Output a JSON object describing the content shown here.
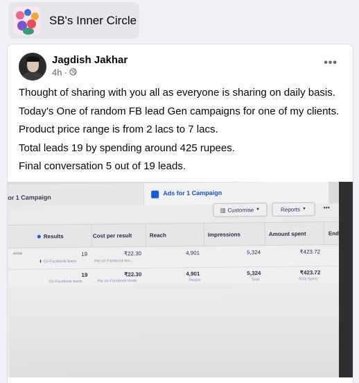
{
  "group": {
    "name": "SB's Inner Circle",
    "logo_icon": "group-cover-image"
  },
  "post": {
    "author": "Jagdish Jakhar",
    "time": "4h",
    "separator": "·",
    "privacy_icon": "globe-icon",
    "more_icon": "more-horizontal-icon",
    "more_text": "•••",
    "paragraphs": [
      "Thought of sharing with you all as everyone is sharing on daily basis.",
      "Today's One of random FB lead Gen campaigns for one of my clients.",
      "Product price range is from 2 lacs  to 7 lacs.",
      "Total leads 19 by spending around 425 rupees.",
      "Final conversation 5 out of 19 leads."
    ]
  },
  "photo": {
    "tabs": [
      "or 1 Campaign",
      "Ads for 1 Campaign"
    ],
    "buttons": {
      "customise": "Customise",
      "reports": "Reports",
      "more": "•••"
    },
    "columns": [
      "Results",
      "Cost per result",
      "Reach",
      "Impressions",
      "Amount spent",
      "Ends"
    ],
    "rows": [
      {
        "first": "ense",
        "results": "19",
        "results_sub": "On-Facebook leads",
        "cost": "₹22.30",
        "cost_sub": "Per on-Facebook lea...",
        "reach": "4,901",
        "reach_sub": "",
        "impressions": "5,324",
        "impressions_sub": "",
        "spent": "₹423.72",
        "spent_sub": ""
      },
      {
        "first": "",
        "results": "19",
        "results_sub": "On-Facebook leads",
        "cost": "₹22.30",
        "cost_sub": "Per on-Facebook leads",
        "reach": "4,901",
        "reach_sub": "People",
        "impressions": "5,324",
        "impressions_sub": "Total",
        "spent": "₹423.72",
        "spent_sub": "Total Spent"
      }
    ]
  },
  "colors": {
    "accent": "#1a5bd6",
    "card_bg": "#ffffff",
    "page_bg": "#f0f2f5"
  }
}
